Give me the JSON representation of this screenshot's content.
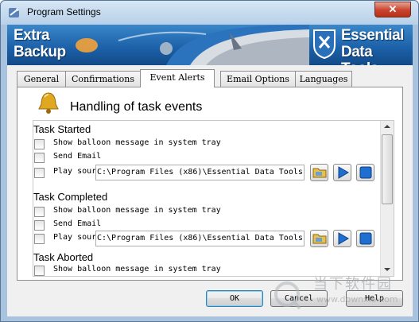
{
  "window": {
    "title": "Program Settings",
    "close_glyph": "✕"
  },
  "banner": {
    "left_line1": "Extra",
    "left_line2": "Backup",
    "right_line1": "Essential",
    "right_line2": "Data Tools"
  },
  "tabs": [
    {
      "label": "General",
      "active": false
    },
    {
      "label": "Confirmations",
      "active": false
    },
    {
      "label": "Event Alerts",
      "active": true
    },
    {
      "label": "Email Options",
      "active": false
    },
    {
      "label": "Languages",
      "active": false
    }
  ],
  "panel": {
    "title": "Handling of task events",
    "icon": "bell-icon"
  },
  "sections": [
    {
      "title": "Task Started",
      "options": {
        "balloon": "Show balloon message in system tray",
        "email": "Send Email",
        "sound": "Play sour",
        "sound_path": "C:\\Program Files (x86)\\Essential Data Tools"
      }
    },
    {
      "title": "Task Completed",
      "options": {
        "balloon": "Show balloon message in system tray",
        "email": "Send Email",
        "sound": "Play sour",
        "sound_path": "C:\\Program Files (x86)\\Essential Data Tools"
      }
    },
    {
      "title": "Task Aborted",
      "options": {
        "balloon": "Show balloon message in system tray"
      }
    }
  ],
  "buttons": {
    "ok": "OK",
    "cancel": "Cancel",
    "help": "Help"
  },
  "watermark": {
    "text": "当下软件园",
    "sub": "www.downxia.com"
  },
  "colors": {
    "banner": "#1b5fa7",
    "play": "#1f6fd1",
    "stop": "#1f6fd1",
    "titlebar": "#b8d0e8"
  }
}
